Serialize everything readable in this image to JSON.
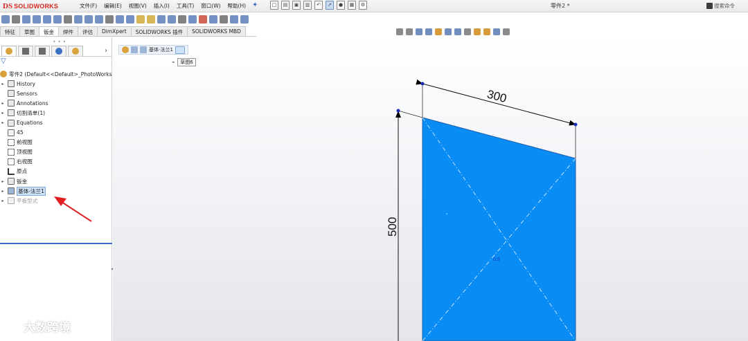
{
  "app": {
    "logo_prefix": "DS",
    "logo_name": "SOLIDWORKS",
    "document_title": "零件2 *",
    "search_placeholder": "搜索命令"
  },
  "menu": [
    {
      "label": "文件(F)"
    },
    {
      "label": "编辑(E)"
    },
    {
      "label": "视图(V)"
    },
    {
      "label": "插入(I)"
    },
    {
      "label": "工具(T)"
    },
    {
      "label": "窗口(W)"
    },
    {
      "label": "帮助(H)"
    }
  ],
  "command_tabs": [
    {
      "label": "特征",
      "active": false
    },
    {
      "label": "草图",
      "active": false
    },
    {
      "label": "钣金",
      "active": true
    },
    {
      "label": "焊件",
      "active": false
    },
    {
      "label": "评估",
      "active": false
    },
    {
      "label": "DimXpert",
      "active": false
    },
    {
      "label": "SOLIDWORKS 插件",
      "active": false
    },
    {
      "label": "SOLIDWORKS MBD",
      "active": false
    }
  ],
  "feature_tree": {
    "root": "零件2  (Default<<Default>_PhotoWorks",
    "items": [
      {
        "label": "History",
        "icon": "history-icon"
      },
      {
        "label": "Sensors",
        "icon": "sensors-icon"
      },
      {
        "label": "Annotations",
        "icon": "annotations-icon"
      },
      {
        "label": "切割清单(1)",
        "icon": "cut-list-icon"
      },
      {
        "label": "Equations",
        "icon": "equations-icon"
      },
      {
        "label": "45",
        "icon": "material-icon"
      },
      {
        "label": "前视图",
        "icon": "plane-icon"
      },
      {
        "label": "顶视图",
        "icon": "plane-icon"
      },
      {
        "label": "右视图",
        "icon": "plane-icon"
      },
      {
        "label": "原点",
        "icon": "origin-icon"
      },
      {
        "label": "钣金",
        "icon": "sheet-metal-icon"
      },
      {
        "label": "基体-法兰1",
        "icon": "base-flange-icon",
        "highlighted": true
      },
      {
        "label": "平板型式",
        "icon": "flat-pattern-icon",
        "dimmed": true
      }
    ]
  },
  "breadcrumb": {
    "feature": "基体-法兰1",
    "sketch": "草图6"
  },
  "model": {
    "width_dimension": "300",
    "height_dimension": "500",
    "thickness_note": "0.5",
    "face_color": "#0a8cf5"
  },
  "watermark": "大数跨境"
}
